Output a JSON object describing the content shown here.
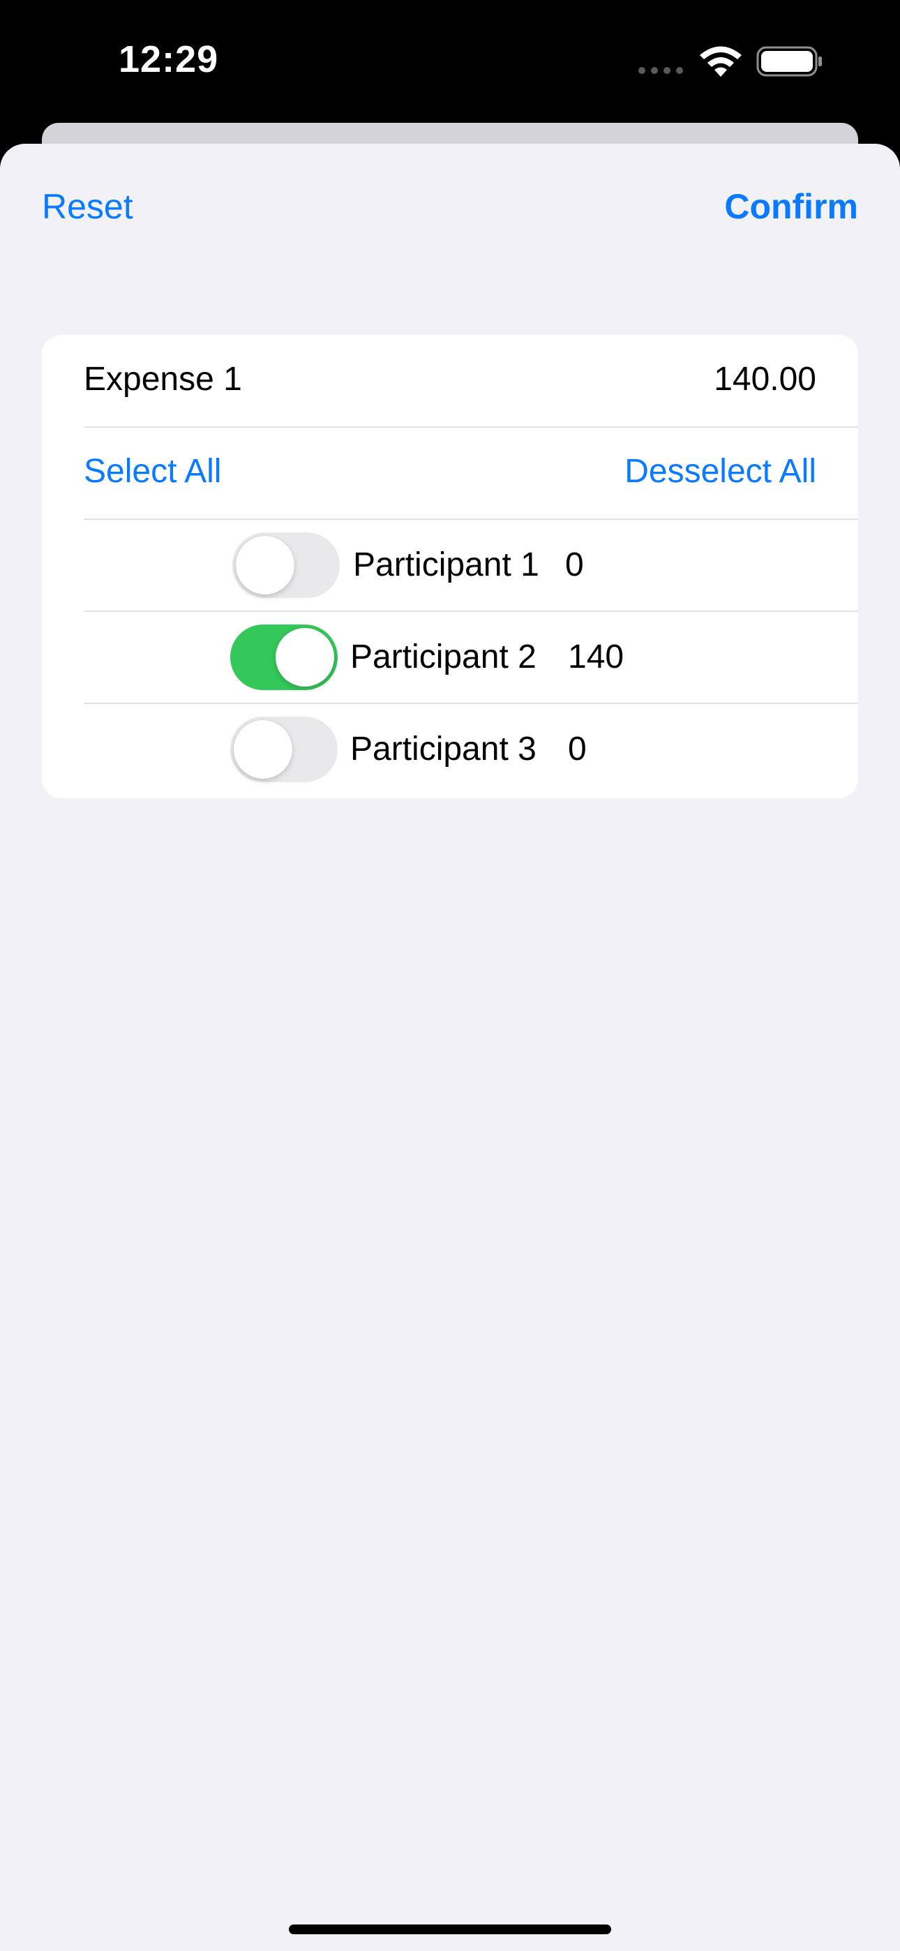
{
  "status_bar": {
    "time": "12:29"
  },
  "nav": {
    "reset_label": "Reset",
    "confirm_label": "Confirm"
  },
  "expense": {
    "name": "Expense 1",
    "amount": "140.00"
  },
  "selection": {
    "select_all_label": "Select All",
    "deselect_all_label": "Desselect All"
  },
  "participants": [
    {
      "name": "Participant 1",
      "amount": "0",
      "enabled": false
    },
    {
      "name": "Participant 2",
      "amount": "140",
      "enabled": true
    },
    {
      "name": "Participant 3",
      "amount": "0",
      "enabled": false
    }
  ],
  "colors": {
    "accent": "#0a7aff",
    "toggle_on": "#34c759",
    "toggle_off": "#e9e9eb",
    "sheet_background": "#f1f1f6"
  }
}
